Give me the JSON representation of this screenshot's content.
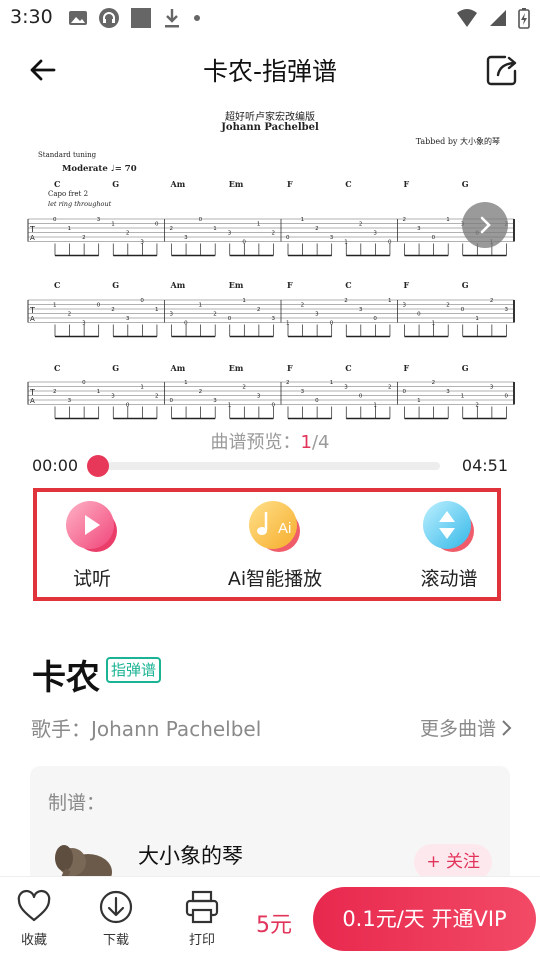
{
  "status_bar": {
    "time": "3:30"
  },
  "header": {
    "title": "卡农-指弹谱"
  },
  "score": {
    "subtitle": "超好听卢家宏改编版",
    "composer": "Johann Pachelbel",
    "tabbed_by": "Tabbed by 大小象的琴",
    "tuning": "Standard tuning",
    "tempo": "Moderate ♩= 70",
    "capo": "Capo fret 2",
    "let_ring": "let ring throughout",
    "system1_chords": [
      "C",
      "G",
      "Am",
      "Em",
      "F",
      "C",
      "F",
      "G"
    ],
    "system2_chords": [
      "C",
      "G",
      "Am",
      "Em",
      "F",
      "C",
      "F",
      "G"
    ],
    "system3_chords": [
      "C",
      "G",
      "Am",
      "Em",
      "F",
      "C",
      "F",
      "G"
    ]
  },
  "preview": {
    "label": "曲谱预览：",
    "current": "1",
    "total": "/4"
  },
  "player": {
    "start_time": "00:00",
    "end_time": "04:51",
    "progress": 0.0
  },
  "actions": {
    "listen": "试听",
    "ai_play": "Ai智能播放",
    "scroll": "滚动谱"
  },
  "song": {
    "title": "卡农",
    "tag": "指弹谱",
    "singer": "歌手：Johann Pachelbel",
    "more": "更多曲谱"
  },
  "maker": {
    "label": "制谱：",
    "name": "大小象的琴",
    "follow": "+ 关注"
  },
  "bottom": {
    "favorite": "收藏",
    "download": "下载",
    "print": "打印",
    "price": "5元",
    "vip": "0.1元/天  开通VIP"
  },
  "colors": {
    "accent": "#e2345a",
    "tag_green": "#1ab394",
    "highlight_border": "#e0333c"
  }
}
